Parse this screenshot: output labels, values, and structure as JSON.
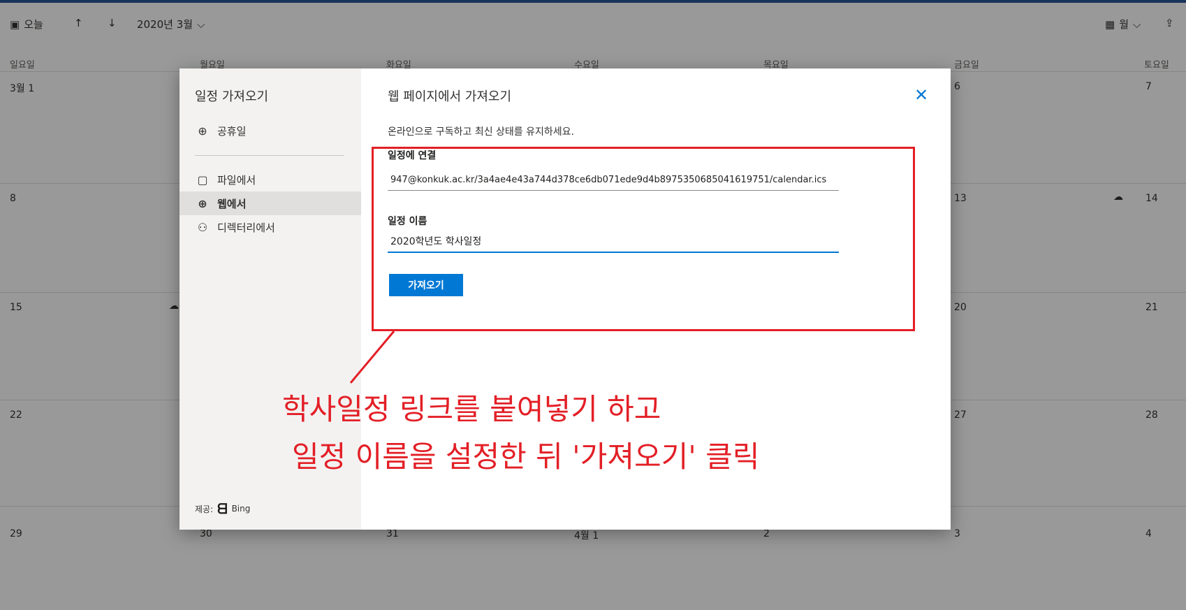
{
  "toolbar": {
    "today": "오늘",
    "month_label": "2020년 3월",
    "view_label": "월"
  },
  "calendar": {
    "day_headers": [
      "일요일",
      "월요일",
      "화요일",
      "수요일",
      "목요일",
      "금요일",
      "토요일"
    ],
    "weeks": [
      [
        "3월 1",
        "",
        "",
        "",
        "",
        "6",
        "7"
      ],
      [
        "8",
        "",
        "",
        "",
        "",
        "13",
        "14"
      ],
      [
        "15",
        "",
        "",
        "",
        "",
        "20",
        "21"
      ],
      [
        "22",
        "",
        "",
        "",
        "",
        "27",
        "28"
      ],
      [
        "29",
        "30",
        "31",
        "4월 1",
        "2",
        "3",
        "4"
      ]
    ]
  },
  "dialog": {
    "sidebar": {
      "title": "일정 가져오기",
      "items": [
        {
          "label": "공휴일",
          "icon": "globe-icon"
        },
        {
          "label": "파일에서",
          "icon": "file-icon"
        },
        {
          "label": "웹에서",
          "icon": "globe-icon"
        },
        {
          "label": "디렉터리에서",
          "icon": "people-icon"
        }
      ],
      "provider_label": "제공:",
      "provider_name": "Bing"
    },
    "main": {
      "title": "웹 페이지에서 가져오기",
      "subtitle": "온라인으로 구독하고 최신 상태를 유지하세요.",
      "link_label": "일정에 연결",
      "link_value": "947@konkuk.ac.kr/3a4ae4e43a744d378ce6db071ede9d4b8975350685041619751/calendar.ics",
      "name_label": "일정 이름",
      "name_value": "2020학년도 학사일정",
      "import_button": "가져오기"
    }
  },
  "annotation": {
    "line1": "학사일정 링크를 붙여넣기 하고",
    "line2": "일정 이름을 설정한 뒤 '가져오기' 클릭",
    "color": "#e31f26"
  }
}
